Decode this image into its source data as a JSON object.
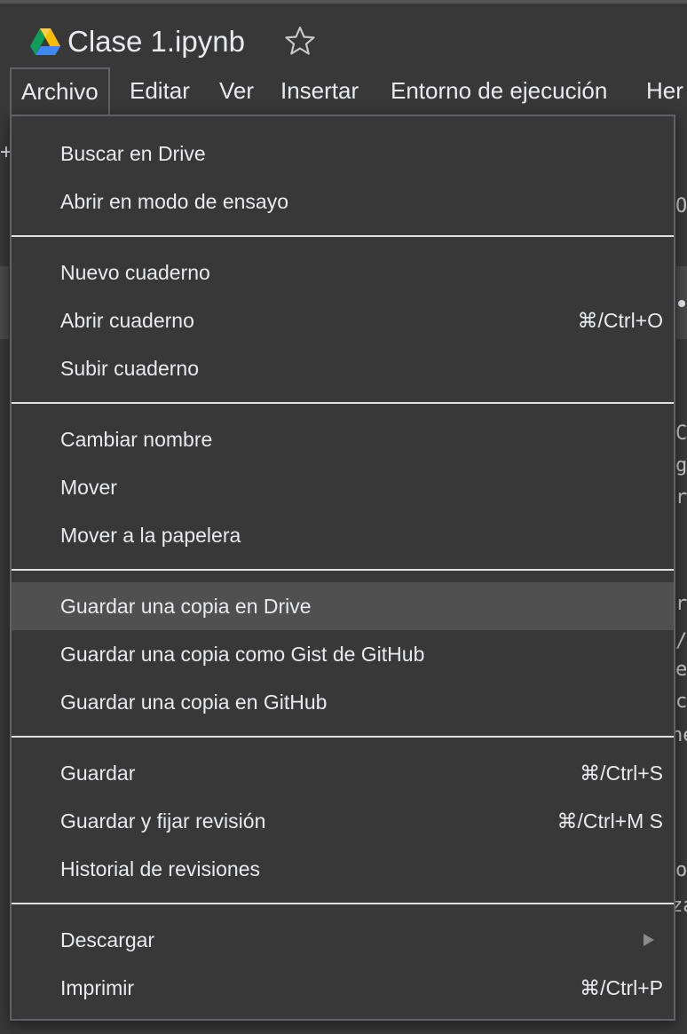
{
  "window": {
    "doc_title": "Clase 1.ipynb"
  },
  "menubar": {
    "items": [
      {
        "label": "Archivo"
      },
      {
        "label": "Editar"
      },
      {
        "label": "Ver"
      },
      {
        "label": "Insertar"
      },
      {
        "label": "Entorno de ejecución"
      },
      {
        "label": "Her"
      }
    ]
  },
  "background": {
    "left_fragment": "+",
    "right_fragments": [
      "O",
      "C",
      "g",
      "r",
      "r",
      "/",
      "e",
      "c",
      "ne",
      "o",
      "za"
    ]
  },
  "archivo_menu": {
    "groups": [
      {
        "items": [
          {
            "label": "Buscar en Drive",
            "shortcut": ""
          },
          {
            "label": "Abrir en modo de ensayo",
            "shortcut": ""
          }
        ]
      },
      {
        "items": [
          {
            "label": "Nuevo cuaderno",
            "shortcut": ""
          },
          {
            "label": "Abrir cuaderno",
            "shortcut": "⌘/Ctrl+O"
          },
          {
            "label": "Subir cuaderno",
            "shortcut": ""
          }
        ]
      },
      {
        "items": [
          {
            "label": "Cambiar nombre",
            "shortcut": ""
          },
          {
            "label": "Mover",
            "shortcut": ""
          },
          {
            "label": "Mover a la papelera",
            "shortcut": ""
          }
        ]
      },
      {
        "items": [
          {
            "label": "Guardar una copia en Drive",
            "shortcut": "",
            "highlighted": true
          },
          {
            "label": "Guardar una copia como Gist de GitHub",
            "shortcut": ""
          },
          {
            "label": "Guardar una copia en GitHub",
            "shortcut": ""
          }
        ]
      },
      {
        "items": [
          {
            "label": "Guardar",
            "shortcut": "⌘/Ctrl+S"
          },
          {
            "label": "Guardar y fijar revisión",
            "shortcut": "⌘/Ctrl+M S"
          },
          {
            "label": "Historial de revisiones",
            "shortcut": ""
          }
        ]
      },
      {
        "items": [
          {
            "label": "Descargar",
            "shortcut": "",
            "submenu": true
          },
          {
            "label": "Imprimir",
            "shortcut": "⌘/Ctrl+P"
          }
        ]
      }
    ]
  },
  "icons": {
    "logo": "google-drive-logo",
    "star": "star-outline-icon",
    "submenu": "submenu-arrow-icon"
  }
}
